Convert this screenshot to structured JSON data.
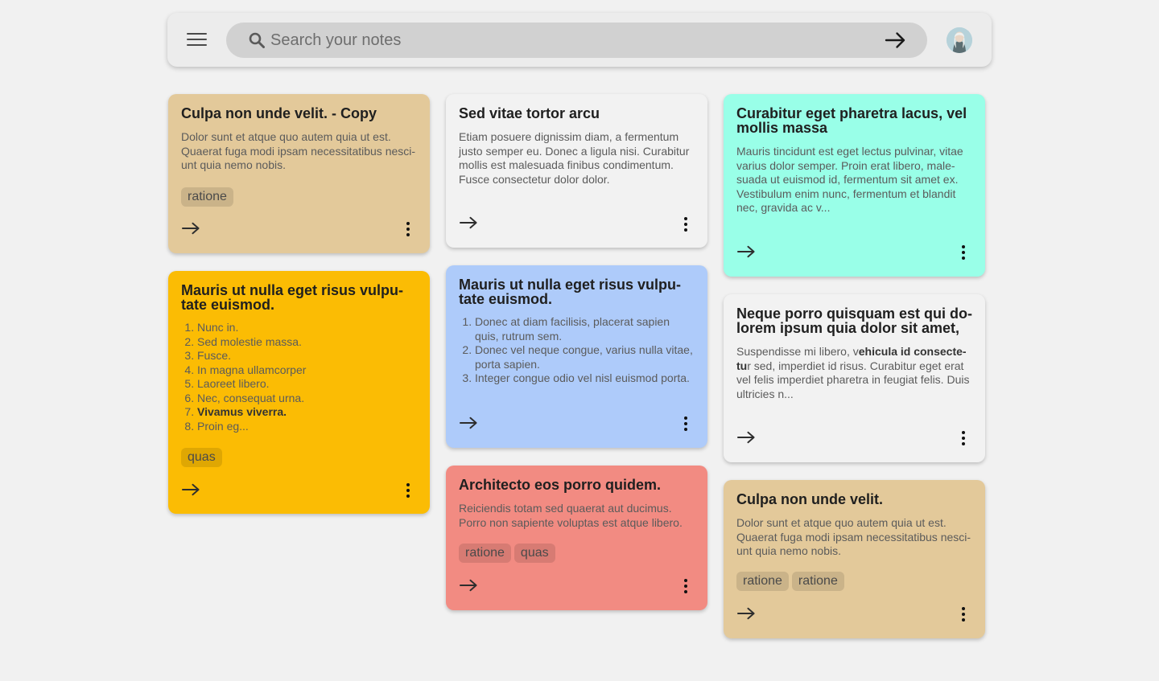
{
  "header": {
    "search": {
      "placeholder": "Search your notes",
      "value": ""
    },
    "icons": [
      "menu-icon",
      "search-icon",
      "arrow-right-icon",
      "avatar"
    ]
  },
  "notes": [
    {
      "title": "Culpa non unde velit. - Copy",
      "color": "#e3c99a",
      "body": "Dolor sunt et atque quo autem quia ut est. Quaerat fuga modi ipsam necessitatibus nesci-unt quia nemo nobis.",
      "tags": [
        "ratione"
      ]
    },
    {
      "title": "Sed vitae tortor arcu",
      "color": "#f2f2f2",
      "body": "Etiam posuere dignissim diam, a fermentum justo semper eu. Donec a ligula nisi. Curabitur mollis est malesuada finibus condimentum. Fusce consectetur dolor dolor.",
      "tags": []
    },
    {
      "title": "Curabitur eget pharetra lacus, vel mollis massa",
      "color": "#99ffe8",
      "body": "Mauris tincidunt est eget lectus pulvinar, vitae varius dolor semper. Proin erat libero, male-suada ut euismod id, fermentum sit amet ex. Vestibulum enim nunc, fermentum et blandit nec, gravida ac v...",
      "tags": []
    },
    {
      "title": "Mauris ut nulla eget risus vulpu-tate euismod.",
      "color": "#fbbc04",
      "list": [
        "Nunc in.",
        "Sed molestie massa.",
        "Fusce.",
        "In magna ullamcorper",
        "Laoreet libero.",
        "Nec, consequat urna.",
        "Vivamus viverra.",
        "Proin eg..."
      ],
      "bold_item_index": 6,
      "tags": [
        "quas"
      ]
    },
    {
      "title": "Mauris ut nulla eget risus vulpu-tate euismod.",
      "color": "#aecbfa",
      "list": [
        "Donec at diam facilisis, placerat sapien quis, rutrum sem.",
        "Donec vel neque congue, varius nulla vitae, porta sapien.",
        "Integer congue odio vel nisl euismod porta."
      ],
      "tags": []
    },
    {
      "title": "Neque porro quisquam est qui do-lorem ipsum quia dolor sit amet,",
      "color": "#f2f2f2",
      "body_pre": "Suspendisse mi libero, v",
      "body_bold": "ehicula id consecte-tu",
      "body_post": "r sed, imperdiet id risus. Curabitur eget erat vel felis imperdiet pharetra in feugiat felis. Duis ultricies n...",
      "tags": []
    },
    {
      "title": "Architecto eos porro quidem.",
      "color": "#f28b82",
      "body": "Reiciendis totam sed quaerat aut ducimus. Porro non sapiente voluptas est atque libero.",
      "tags": [
        "ratione",
        "quas"
      ]
    },
    {
      "title": "Culpa non unde velit.",
      "color": "#e3c99a",
      "body": "Dolor sunt et atque quo autem quia ut est. Quaerat fuga modi ipsam necessitatibus nesci-unt quia nemo nobis.",
      "tags": [
        "ratione",
        "ratione"
      ]
    }
  ]
}
